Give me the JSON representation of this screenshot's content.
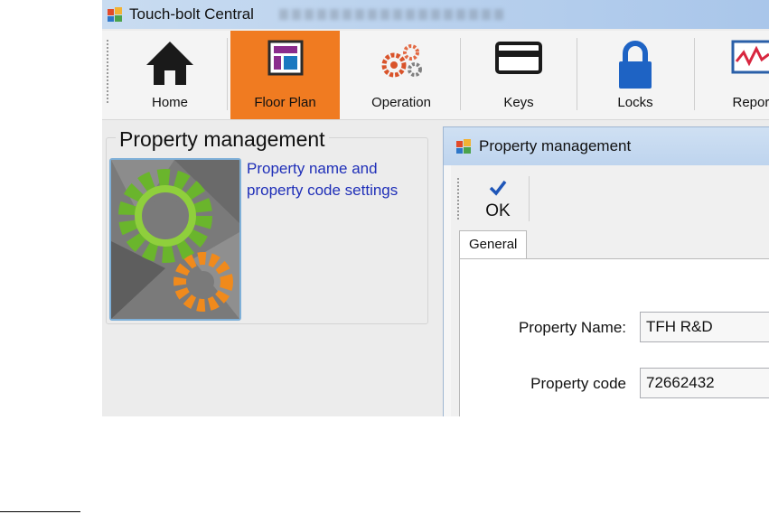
{
  "window": {
    "title": "Touch-bolt Central"
  },
  "toolbar": {
    "items": [
      {
        "label": "Home"
      },
      {
        "label": "Floor Plan",
        "active": true
      },
      {
        "label": "Operation"
      },
      {
        "label": "Keys"
      },
      {
        "label": "Locks"
      },
      {
        "label": "Report"
      }
    ]
  },
  "panel": {
    "title": "Property management",
    "link": "Property name and property code settings"
  },
  "dialog": {
    "title": "Property management",
    "ok_label": "OK",
    "tab_label": "General",
    "fields": {
      "property_name_label": "Property Name:",
      "property_name_value": "TFH R&D",
      "property_code_label": "Property code",
      "property_code_value": "72662432"
    }
  },
  "colors": {
    "active_tab": "#f07b21",
    "link": "#1f2fb8",
    "titlebar": "#bcd3ee"
  },
  "icons": {
    "home": "house-icon",
    "floor_plan": "floor-plan-icon",
    "operation": "gears-icon",
    "keys": "card-key-icon",
    "locks": "padlock-icon",
    "report": "chart-report-icon"
  }
}
